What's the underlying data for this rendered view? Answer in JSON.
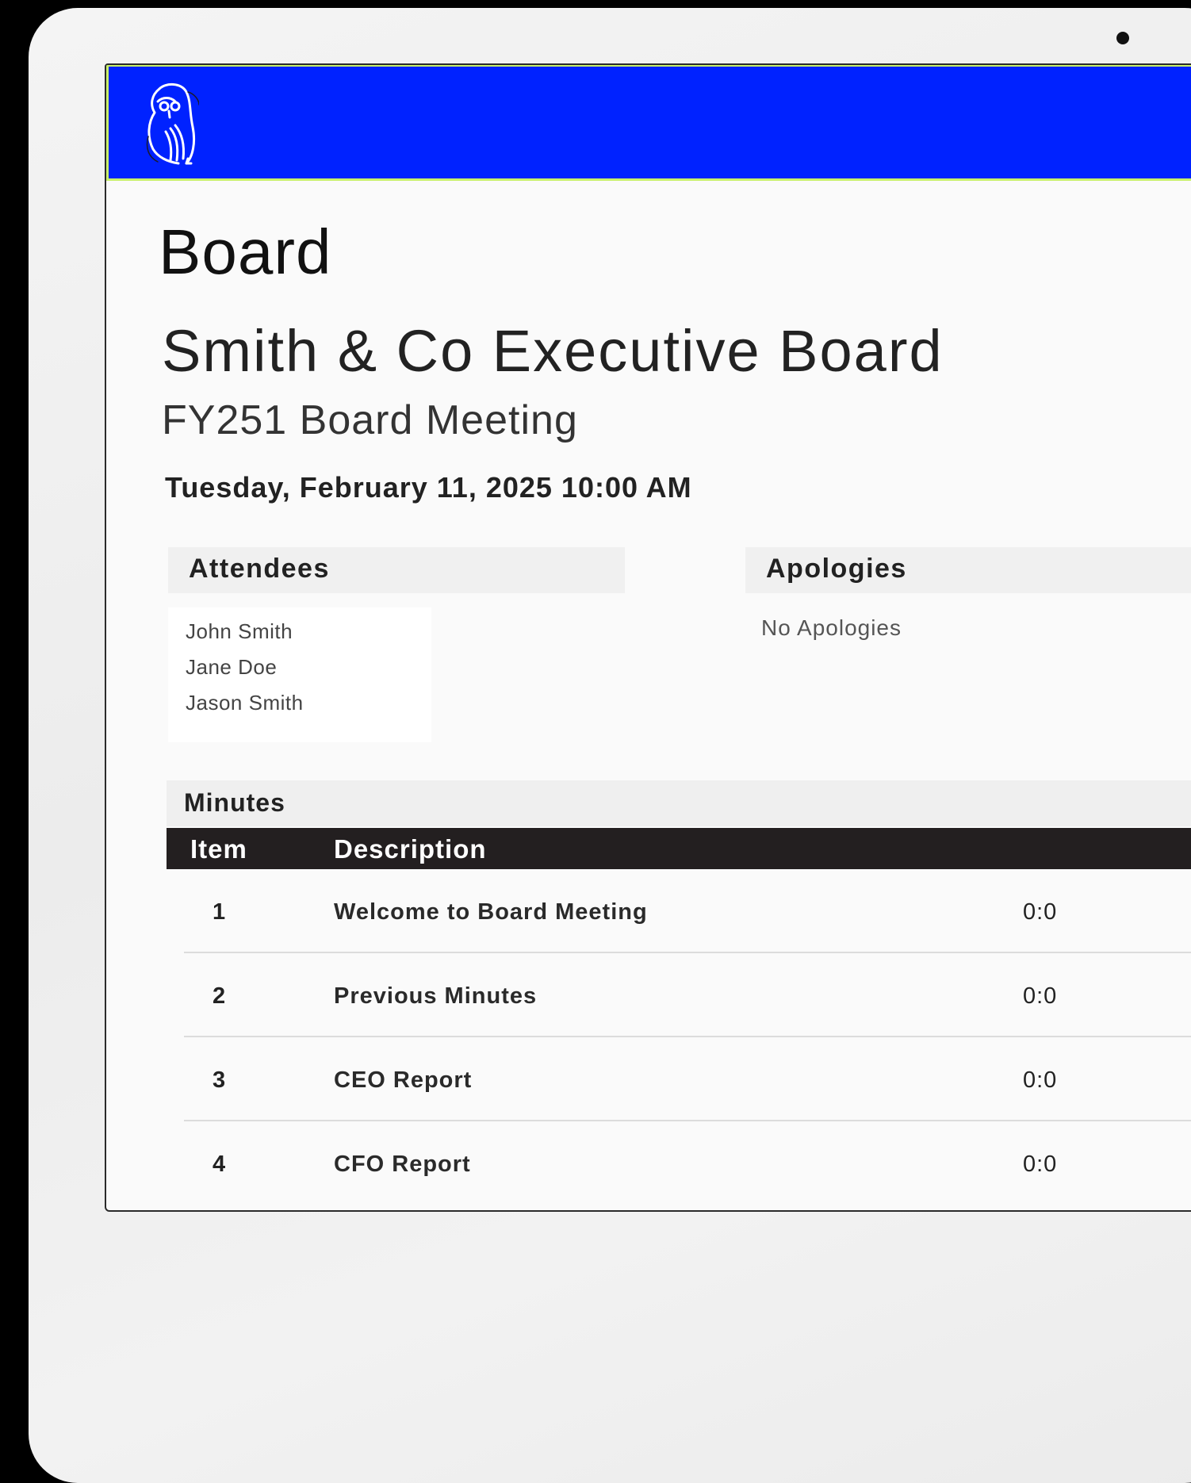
{
  "page": {
    "section_title": "Board",
    "organization": "Smith & Co Executive Board",
    "meeting_name": "FY251 Board Meeting",
    "meeting_datetime": "Tuesday, February 11, 2025 10:00 AM"
  },
  "header": {
    "logo_icon": "owl-logo-icon",
    "bar_color": "#0022ff",
    "accent_color": "#c9f06a"
  },
  "attendees": {
    "heading": "Attendees",
    "names": [
      "John Smith",
      "Jane Doe",
      "Jason Smith"
    ]
  },
  "apologies": {
    "heading": "Apologies",
    "empty_text": "No Apologies"
  },
  "minutes": {
    "heading": "Minutes",
    "columns": [
      "Item",
      "Description"
    ],
    "rows": [
      {
        "item": "1",
        "description": "Welcome to Board Meeting",
        "duration": "0:0"
      },
      {
        "item": "2",
        "description": "Previous Minutes",
        "duration": "0:0"
      },
      {
        "item": "3",
        "description": "CEO Report",
        "duration": "0:0"
      },
      {
        "item": "4",
        "description": "CFO Report",
        "duration": "0:0"
      }
    ]
  }
}
